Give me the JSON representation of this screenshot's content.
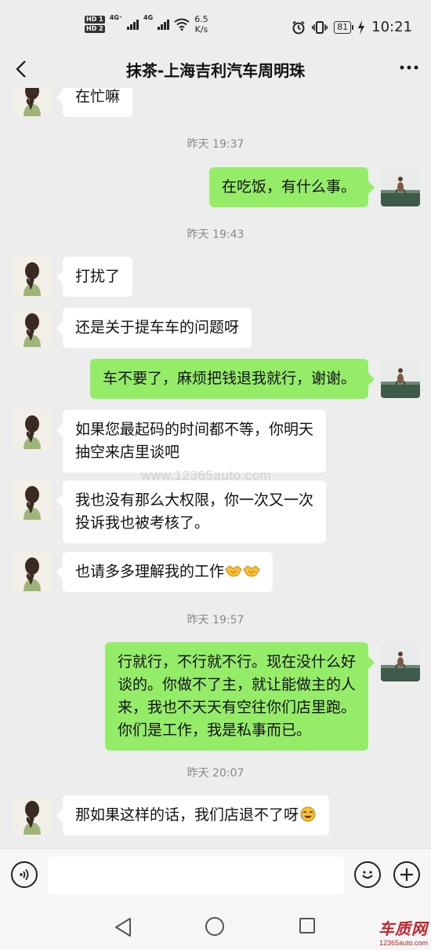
{
  "status_bar": {
    "hd1": "HD 1",
    "hd2": "HD 2",
    "net1": "4G⁺",
    "net2": "4G",
    "speed_value": "6.5",
    "speed_unit": "K/s",
    "battery": "81",
    "time": "10:21"
  },
  "header": {
    "title": "抹茶-上海吉利汽车周明珠",
    "back_icon": "chevron-left-icon",
    "more_icon": "more-dots-icon"
  },
  "messages": {
    "m0": "在忙嘛",
    "t1": "昨天 19:37",
    "m1": "在吃饭，有什么事。",
    "t2": "昨天 19:43",
    "m2": "打扰了",
    "m3": "还是关于提车车的问题呀",
    "m4": "车不要了，麻烦把钱退我就行，谢谢。",
    "m5": "如果您最起码的时间都不等，你明天\n抽空来店里谈吧",
    "m6": "我也没有那么大权限，你一次又一次\n投诉我也被考核了。",
    "m7": "也请多多理解我的工作",
    "t3": "昨天 19:57",
    "m8": "行就行，不行就不行。现在没什么好\n谈的。你做不了主，就让能做主的人\n来，我也不天天有空往你们店里跑。\n你们是工作，我是私事而已。",
    "t4": "昨天 20:07",
    "m9": "那如果这样的话，我们店退不了呀"
  },
  "watermark": "www.12365auto.com",
  "input_bar": {
    "voice_icon": "voice-icon",
    "emoji_icon": "emoji-icon",
    "plus_icon": "plus-icon"
  },
  "brand": {
    "name": "车质网",
    "url": "12365auto.com"
  },
  "colors": {
    "outgoing_bubble": "#95ec69",
    "incoming_bubble": "#ffffff",
    "background": "#ededed"
  }
}
